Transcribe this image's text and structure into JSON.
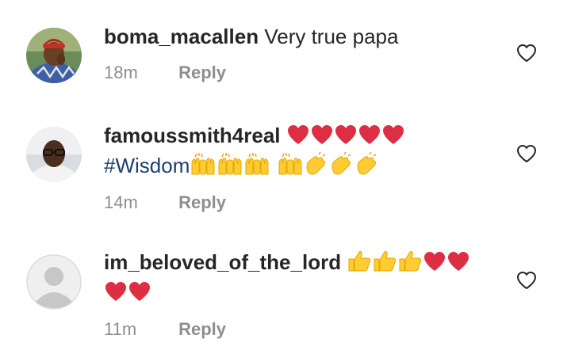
{
  "comments": [
    {
      "username": "boma_macallen",
      "text": "Very true papa",
      "time": "18m",
      "reply_label": "Reply",
      "avatar": "user-photo-red-cap"
    },
    {
      "username": "famoussmith4real",
      "hashtag": "#Wisdom",
      "time": "14m",
      "reply_label": "Reply",
      "emoji_line1": [
        "red-heart",
        "red-heart",
        "red-heart",
        "red-heart",
        "red-heart"
      ],
      "emoji_line2": [
        "raising-hands",
        "raising-hands",
        "raising-hands",
        "raising-hands",
        "clapping-hands",
        "clapping-hands",
        "clapping-hands"
      ],
      "avatar": "user-photo-glasses"
    },
    {
      "username": "im_beloved_of_the_lord",
      "time": "11m",
      "reply_label": "Reply",
      "emoji_line1": [
        "thumbs-up",
        "thumbs-up",
        "thumbs-up",
        "red-heart",
        "red-heart"
      ],
      "emoji_line2": [
        "red-heart",
        "red-heart"
      ],
      "avatar": "default-avatar"
    }
  ],
  "colors": {
    "text": "#262626",
    "meta": "#8e8e8e",
    "hashtag": "#1c3f6e",
    "heart": "#dd2e44",
    "emoji_yellow": "#ffcc33"
  },
  "icons": {
    "like": "heart-outline-icon"
  }
}
